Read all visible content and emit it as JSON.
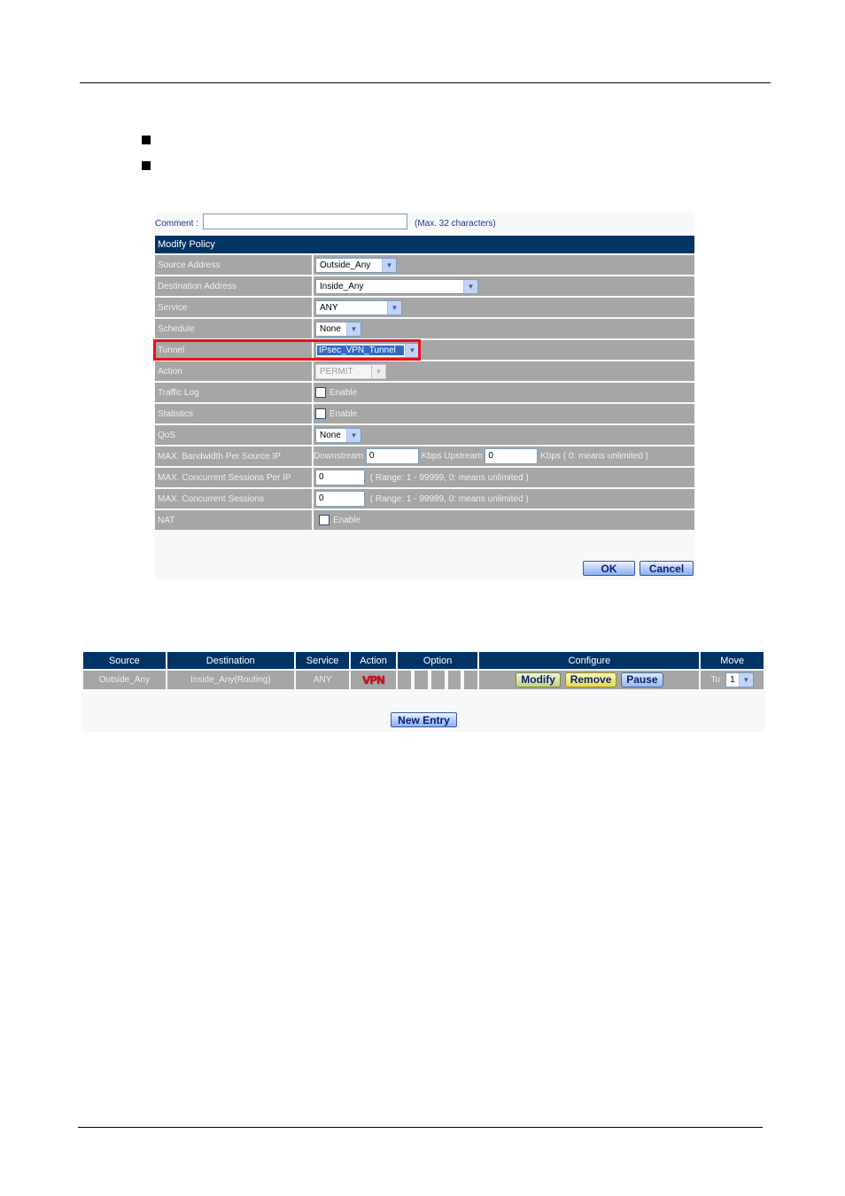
{
  "form": {
    "comment_label": "Comment :",
    "comment_value": "",
    "comment_hint": "(Max. 32 characters)",
    "section_title": "Modify Policy",
    "rows": {
      "source_address": {
        "label": "Source Address",
        "value": "Outside_Any"
      },
      "destination_address": {
        "label": "Destination Address",
        "value": "Inside_Any"
      },
      "service": {
        "label": "Service",
        "value": "ANY"
      },
      "schedule": {
        "label": "Schedule",
        "value": "None"
      },
      "tunnel": {
        "label": "Tunnel",
        "value": "IPsec_VPN_Tunnel"
      },
      "action": {
        "label": "Action",
        "value": "PERMIT"
      },
      "traffic_log": {
        "label": "Traffic Log",
        "checkbox_label": "Enable",
        "checked": false
      },
      "statistics": {
        "label": "Statistics",
        "checkbox_label": "Enable",
        "checked": false
      },
      "qos": {
        "label": "QoS",
        "value": "None"
      },
      "max_bandwidth": {
        "label": "MAX. Bandwidth Per Source IP",
        "downstream_label": "Downstream",
        "downstream_value": "0",
        "upstream_label": "Kbps Upstream",
        "upstream_value": "0",
        "hint": "Kbps ( 0: means unlimited )"
      },
      "max_sessions_per_ip": {
        "label": "MAX. Concurrent Sessions Per IP",
        "value": "0",
        "hint": "( Range: 1 - 99999, 0: means unlimited )"
      },
      "max_sessions": {
        "label": "MAX. Concurrent Sessions",
        "value": "0",
        "hint": "( Range: 1 - 99999, 0: means unlimited )"
      },
      "nat": {
        "label": "NAT",
        "checkbox_label": "Enable",
        "checked": false
      }
    },
    "ok_label": "OK",
    "cancel_label": "Cancel"
  },
  "rules_table": {
    "headers": [
      "Source",
      "Destination",
      "Service",
      "Action",
      "Option",
      "Configure",
      "Move"
    ],
    "rows": [
      {
        "source": "Outside_Any",
        "destination": "Inside_Any(Routing)",
        "service": "ANY",
        "action_icon": "VPN",
        "configure": {
          "modify": "Modify",
          "remove": "Remove",
          "pause": "Pause"
        },
        "move_label": "To",
        "move_value": "1"
      }
    ],
    "new_entry_label": "New Entry"
  },
  "colors": {
    "header_bg": "#003366",
    "row_bg": "#a6a6a6",
    "highlight": "#e8101a",
    "vpn_icon": "#cc1020"
  }
}
